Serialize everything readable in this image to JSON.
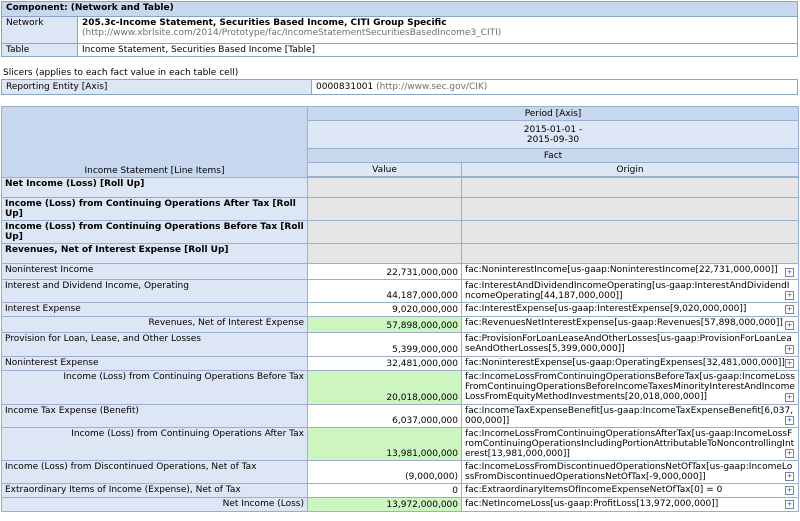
{
  "component": {
    "header": "Component: (Network and Table)",
    "network_label": "Network",
    "network_title": "205.3c-Income Statement, Securities Based Income, CITI Group Specific",
    "network_url": "(http://www.xbrlsite.com/2014/Prototype/fac/IncomeStatementSecuritiesBasedIncome3_CITI)",
    "table_label": "Table",
    "table_value": "Income Statement, Securities Based Income [Table]"
  },
  "slicers": {
    "label": "Slicers (applies to each fact value in each table cell)",
    "axis": "Reporting Entity [Axis]",
    "value": "0000831001",
    "value_url": "(http://www.sec.gov/CIK)"
  },
  "main": {
    "line_items_header": "Income Statement [Line Items]",
    "period_axis": "Period [Axis]",
    "period_from": "2015-01-01 -",
    "period_to": "2015-09-30",
    "fact": "Fact",
    "value_col": "Value",
    "origin_col": "Origin",
    "rows": [
      {
        "label": "Net Income (Loss) [Roll Up]",
        "value": "",
        "origin": ""
      },
      {
        "label": "Income (Loss) from Continuing Operations After Tax [Roll Up]",
        "value": "",
        "origin": ""
      },
      {
        "label": "Income (Loss) from Continuing Operations Before Tax [Roll Up]",
        "value": "",
        "origin": ""
      },
      {
        "label": "Revenues, Net of Interest Expense [Roll Up]",
        "value": "",
        "origin": ""
      },
      {
        "label": "Noninterest Income",
        "value": "22,731,000,000",
        "origin": "fac:NoninterestIncome[us-gaap:NoninterestIncome[22,731,000,000]]"
      },
      {
        "label": "Interest and Dividend Income, Operating",
        "value": "44,187,000,000",
        "origin": "fac:InterestAndDividendIncomeOperating[us-gaap:InterestAndDividendIncomeOperating[44,187,000,000]]"
      },
      {
        "label": "Interest Expense",
        "value": "9,020,000,000",
        "origin": "fac:InterestExpense[us-gaap:InterestExpense[9,020,000,000]]"
      },
      {
        "label": "Revenues, Net of Interest Expense",
        "value": "57,898,000,000",
        "origin": "fac:RevenuesNetInterestExpense[us-gaap:Revenues[57,898,000,000]]"
      },
      {
        "label": "Provision for Loan, Lease, and Other Losses",
        "value": "5,399,000,000",
        "origin": "fac:ProvisionForLoanLeaseAndOtherLosses[us-gaap:ProvisionForLoanLeaseAndOtherLosses[5,399,000,000]]"
      },
      {
        "label": "Noninterest Expense",
        "value": "32,481,000,000",
        "origin": "fac:NoninterestExpense[us-gaap:OperatingExpenses[32,481,000,000]]"
      },
      {
        "label": "Income (Loss) from Continuing Operations Before Tax",
        "value": "20,018,000,000",
        "origin": "fac:IncomeLossFromContinuingOperationsBeforeTax[us-gaap:IncomeLossFromContinuingOperationsBeforeIncomeTaxesMinorityInterestAndIncomeLossFromEquityMethodInvestments[20,018,000,000]]"
      },
      {
        "label": "Income Tax Expense (Benefit)",
        "value": "6,037,000,000",
        "origin": "fac:IncomeTaxExpenseBenefit[us-gaap:IncomeTaxExpenseBenefit[6,037,000,000]]"
      },
      {
        "label": "Income (Loss) from Continuing Operations After Tax",
        "value": "13,981,000,000",
        "origin": "fac:IncomeLossFromContinuingOperationsAfterTax[us-gaap:IncomeLossFromContinuingOperationsIncludingPortionAttributableToNoncontrollingInterest[13,981,000,000]]"
      },
      {
        "label": "Income (Loss) from Discontinued Operations, Net of Tax",
        "value": "(9,000,000)",
        "origin": "fac:IncomeLossFromDiscontinuedOperationsNetOfTax[us-gaap:IncomeLossFromDiscontinuedOperationsNetOfTax[-9,000,000]]"
      },
      {
        "label": "Extraordinary Items of Income (Expense), Net of Tax",
        "value": "0",
        "origin": "fac:ExtraordinaryItemsOfIncomeExpenseNetOfTax[0] = 0"
      },
      {
        "label": "Net Income (Loss)",
        "value": "13,972,000,000",
        "origin": "fac:NetIncomeLoss[us-gaap:ProfitLoss[13,972,000,000]]"
      }
    ],
    "expand_glyph": "+"
  }
}
